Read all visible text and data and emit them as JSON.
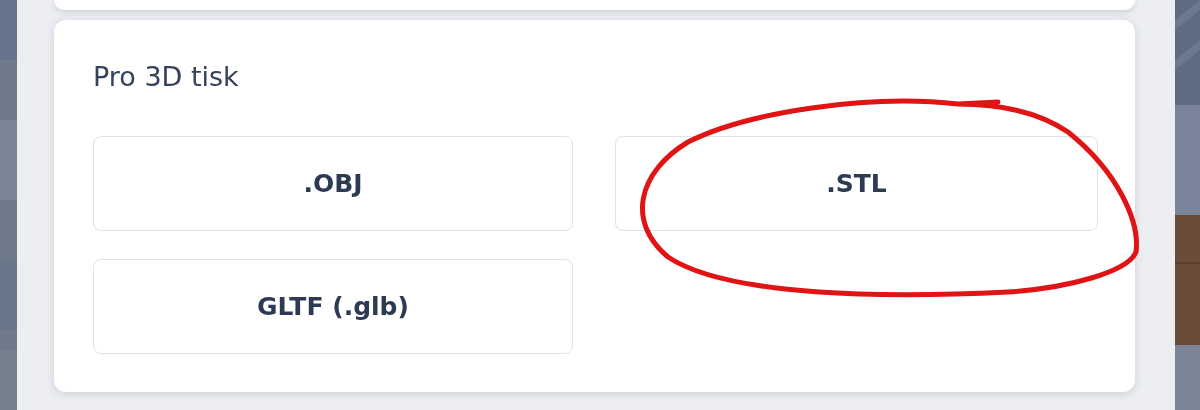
{
  "section": {
    "title": "Pro 3D tisk",
    "buttons": [
      {
        "label": ".OBJ",
        "highlighted": false
      },
      {
        "label": ".STL",
        "highlighted": true
      },
      {
        "label": "GLTF (.glb)",
        "highlighted": false
      }
    ]
  }
}
